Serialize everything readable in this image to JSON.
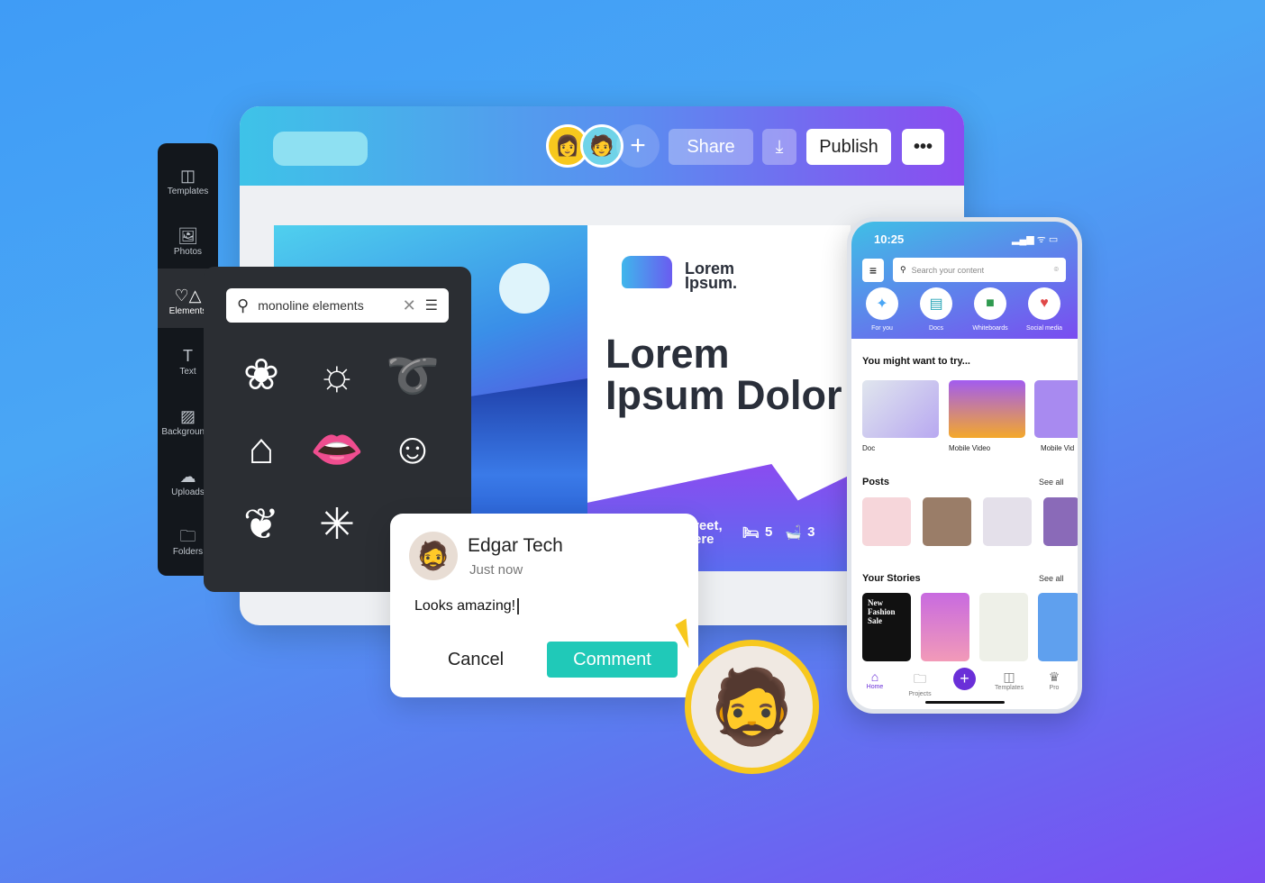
{
  "topbar": {
    "share": "Share",
    "publish": "Publish",
    "more": "•••",
    "add": "+",
    "download": "⤓"
  },
  "sidebar": {
    "items": [
      {
        "label": "Templates",
        "icon": "◫"
      },
      {
        "label": "Photos",
        "icon": "🖼"
      },
      {
        "label": "Elements",
        "icon": "♡△"
      },
      {
        "label": "Text",
        "icon": "T"
      },
      {
        "label": "Backgrounds",
        "icon": "▨"
      },
      {
        "label": "Uploads",
        "icon": "☁"
      },
      {
        "label": "Folders",
        "icon": "🗀"
      }
    ]
  },
  "panel": {
    "search_value": "monoline elements"
  },
  "canvas": {
    "logo": "Lorem Ipsum.",
    "headline1": "Lorem",
    "headline2": "Ipsum Dolor",
    "address1": "reet,",
    "address2": "ere",
    "beds": "5",
    "baths": "3"
  },
  "comment": {
    "name": "Edgar Tech",
    "time": "Just now",
    "text": "Looks amazing!",
    "cancel": "Cancel",
    "submit": "Comment"
  },
  "phone": {
    "time": "10:25",
    "search_placeholder": "Search your content",
    "categories": [
      {
        "label": "For you"
      },
      {
        "label": "Docs"
      },
      {
        "label": "Whiteboards"
      },
      {
        "label": "Social media"
      }
    ],
    "try_title": "You might want to try...",
    "try_items": [
      {
        "label": "Doc"
      },
      {
        "label": "Mobile Video"
      },
      {
        "label": "Mobile Vid"
      }
    ],
    "posts_title": "Posts",
    "see_all": "See all",
    "stories_title": "Your Stories",
    "story1": "New Fashion Sale",
    "nav": [
      {
        "label": "Home",
        "icon": "⌂"
      },
      {
        "label": "Projects",
        "icon": "🗀"
      },
      {
        "label": "Templates",
        "icon": "◫"
      },
      {
        "label": "Pro",
        "icon": "♛"
      }
    ]
  },
  "colors": {
    "accent": "#20c9b8",
    "purple": "#6a2fd8",
    "yellow": "#f7c81e"
  }
}
